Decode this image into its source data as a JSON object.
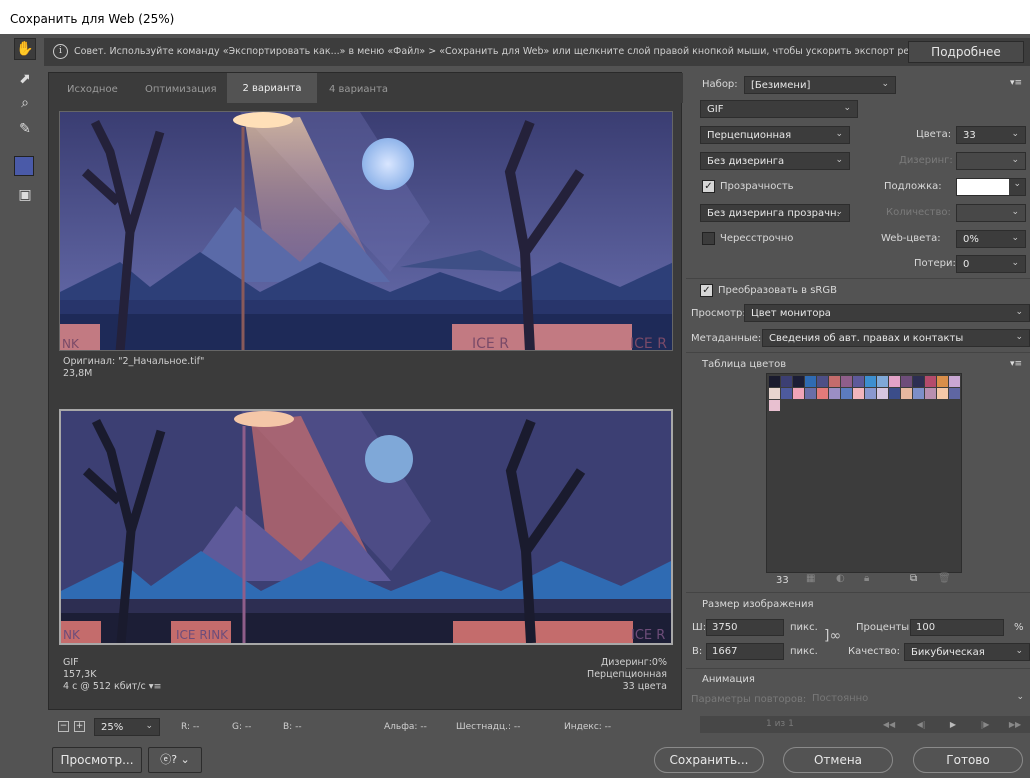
{
  "window": {
    "title": "Сохранить для Web (25%)"
  },
  "tools": {
    "items": [
      {
        "icon": "hand-icon"
      },
      {
        "icon": "slice-select-icon"
      },
      {
        "icon": "zoom-icon"
      },
      {
        "icon": "eyedropper-icon"
      },
      {
        "icon": "eyedropper-color-swatch"
      },
      {
        "icon": "toggle-slices-icon"
      }
    ]
  },
  "tip": {
    "text": "Совет. Используйте команду «Экспортировать как...» в меню «Файл» > «Сохранить для Web» или щелкните слой правой кнопкой мыши, чтобы ускорить экспорт ресурсов",
    "more_label": "Подробнее"
  },
  "tabs": {
    "original": "Исходное",
    "optimized": "Оптимизация",
    "two_up": "2 варианта",
    "four_up": "4 варианта"
  },
  "top_frame": {
    "name": "Оригинал: \"2_Начальное.tif\"",
    "size": "23,8M",
    "sign_left": "NK",
    "sign_center": "ICE R",
    "sign_right": "ICE R"
  },
  "bottom_frame": {
    "format": "GIF",
    "size": "157,3K",
    "time": "4 с @ 512 кбит/с",
    "dither": "Дизеринг:0%",
    "reduction": "Перцепционная",
    "colors": "33 цвета",
    "sign_left": "NK",
    "sign_center": "ICE RINK",
    "sign_right": "ICE R"
  },
  "zoom": {
    "value": "25%"
  },
  "status": {
    "r": "R: --",
    "g": "G: --",
    "b": "B: --",
    "alpha": "Альфа: --",
    "hex": "Шестнадц.: --",
    "index": "Индекс: --"
  },
  "settings": {
    "preset_label": "Набор:",
    "preset_value": "[Безимени]",
    "format": "GIF",
    "reduction": "Перцепционная",
    "colors_label": "Цвета:",
    "colors_value": "33",
    "dither": "Без дизеринга",
    "dither_label": "Дизеринг:",
    "transparency": "Прозрачность",
    "matte_label": "Подложка:",
    "trans_dither": "Без дизеринга прозрачн.",
    "amount_label": "Количество:",
    "interlaced": "Чересстрочно",
    "websnap_label": "Web-цвета:",
    "websnap_value": "0%",
    "lossy_label": "Потери:",
    "lossy_value": "0",
    "convert_srgb": "Преобразовать в sRGB",
    "preview_label": "Просмотр:",
    "preview_value": "Цвет монитора",
    "metadata_label": "Метаданные:",
    "metadata_value": "Сведения об авт. правах и контакты"
  },
  "color_table": {
    "title": "Таблица цветов",
    "count": "33",
    "swatches": [
      "#1a1b2e",
      "#3c3f73",
      "#1c1e36",
      "#2f6bb3",
      "#4d4f86",
      "#c46c6c",
      "#8f5e8a",
      "#5e5a9a",
      "#3d8fd0",
      "#7fa8d8",
      "#e2a3c8",
      "#6e4d7a",
      "#2d2e52",
      "#b44b6c",
      "#d98e4a",
      "#c9a7d3",
      "#e8d5cf",
      "#4d5a9e",
      "#f0a5b8",
      "#6a6ea8",
      "#e27a7a",
      "#9b8ec4",
      "#5c7cbf",
      "#f2b6bd",
      "#8a98cf",
      "#d7c6e0",
      "#3b4d8a",
      "#e6b8a0",
      "#7d8fc9",
      "#b88fb0",
      "#f4c7a8",
      "#5f66a3",
      "#e8c0d0"
    ]
  },
  "image_size": {
    "title": "Размер изображения",
    "w_label": "Ш:",
    "w_value": "3750",
    "h_label": "В:",
    "h_value": "1667",
    "unit": "пикс.",
    "percent_label": "Проценты:",
    "percent_value": "100",
    "percent_unit": "%",
    "quality_label": "Качество:",
    "quality_value": "Бикубическая"
  },
  "animation": {
    "title": "Анимация",
    "loop_label": "Параметры повторов:",
    "loop_value": "Постоянно",
    "frame_counter": "1 из 1"
  },
  "buttons": {
    "preview": "Просмотр...",
    "save": "Сохранить...",
    "cancel": "Отмена",
    "done": "Готово"
  }
}
